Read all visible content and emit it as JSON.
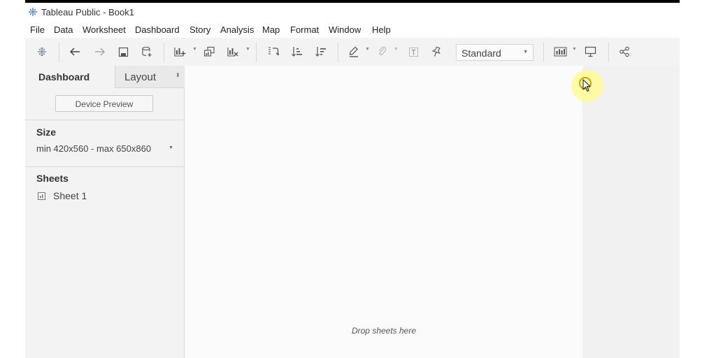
{
  "window": {
    "title": "Tableau Public - Book1",
    "app_icon": "tableau-logo-icon"
  },
  "menu": [
    "File",
    "Data",
    "Worksheet",
    "Dashboard",
    "Story",
    "Analysis",
    "Map",
    "Format",
    "Window",
    "Help"
  ],
  "toolbar": {
    "icons": [
      "tableau-logo-icon",
      "undo-icon",
      "redo-icon",
      "save-icon",
      "new-data-source-icon",
      "new-worksheet-icon",
      "duplicate-icon",
      "clear-sheet-icon",
      "swap-icon",
      "sort-ascending-icon",
      "sort-descending-icon",
      "highlight-icon",
      "group-icon",
      "labels-icon",
      "pin-icon",
      "show-me-icon",
      "presentation-icon",
      "share-icon"
    ],
    "fit_select": {
      "value": "Standard"
    }
  },
  "side_panel": {
    "tabs": [
      {
        "label": "Dashboard",
        "active": true
      },
      {
        "label": "Layout",
        "active": false
      }
    ],
    "device_preview_label": "Device Preview",
    "size": {
      "title": "Size",
      "value": "min 420x560 - max 650x860"
    },
    "sheets": {
      "title": "Sheets",
      "items": [
        {
          "label": "Sheet 1",
          "icon": "worksheet-icon"
        }
      ]
    }
  },
  "canvas": {
    "drop_hint": "Drop sheets here"
  },
  "colors": {
    "accent_orange": "#e8762c",
    "accent_blue": "#1f77b4",
    "cursor_highlight": "#fff796"
  }
}
